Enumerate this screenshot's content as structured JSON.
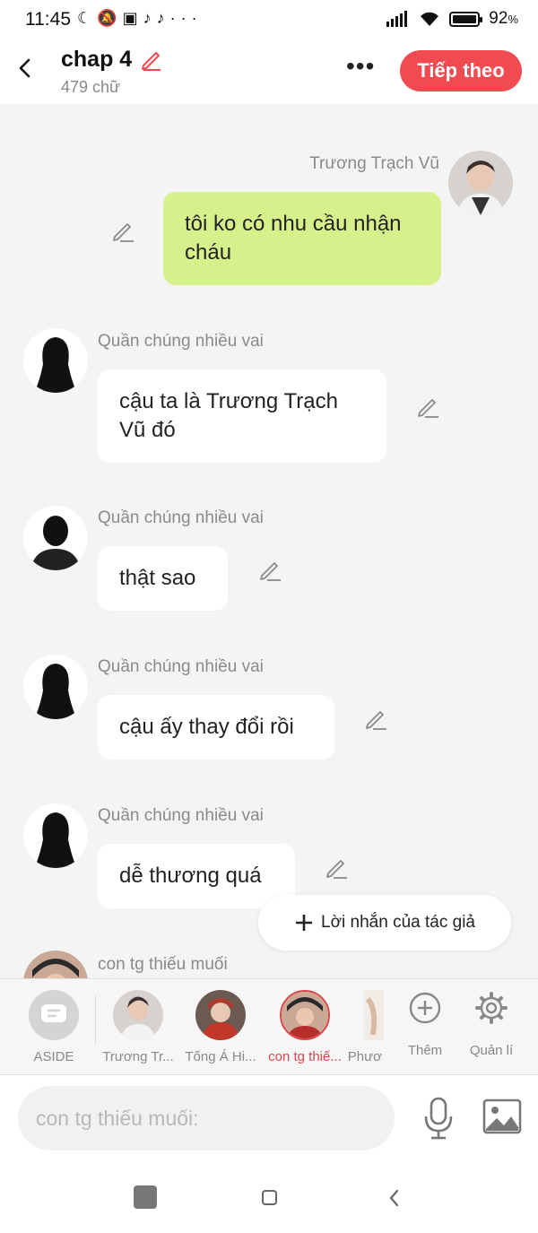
{
  "status": {
    "time": "11:45",
    "icons_left": [
      "moon-icon",
      "mute-icon",
      "shop-icon",
      "tiktok-icon",
      "tiktok-icon",
      "more-icon"
    ],
    "battery_percent": "92",
    "battery_suffix": "%"
  },
  "header": {
    "title": "chap 4",
    "subtitle": "479 chữ",
    "next_label": "Tiếp theo"
  },
  "messages": [
    {
      "name": "Trương Trạch Vũ",
      "text": "tôi ko có nhu cầu nhận cháu",
      "side": "right",
      "bubble_color": "#d6f08c"
    },
    {
      "name": "Quần chúng nhiều vai",
      "text": "cậu ta là  Trương Trạch Vũ đó",
      "side": "left"
    },
    {
      "name": "Quần chúng nhiều vai",
      "text": "thật sao",
      "side": "left"
    },
    {
      "name": "Quần chúng nhiều vai",
      "text": "cậu ấy thay đổi rồi",
      "side": "left"
    },
    {
      "name": "Quần chúng nhiều vai",
      "text": "dễ thương quá",
      "side": "left"
    },
    {
      "name": "con tg thiếu muối",
      "text": "",
      "side": "left"
    }
  ],
  "author_note_label": "Lời nhắn của tác giả",
  "characters": [
    {
      "label": "ASIDE"
    },
    {
      "label": "Trương Tr..."
    },
    {
      "label": "Tống Á Hi..."
    },
    {
      "label": "con tg thiế..."
    },
    {
      "label": "Phươ"
    }
  ],
  "actions": {
    "add_label": "Thêm",
    "manage_label": "Quản lí"
  },
  "input": {
    "placeholder": "con tg thiếu muối:"
  },
  "colors": {
    "accent": "#ef4b51",
    "my_bubble": "#d6f08c",
    "selected_label": "#d9474c"
  }
}
